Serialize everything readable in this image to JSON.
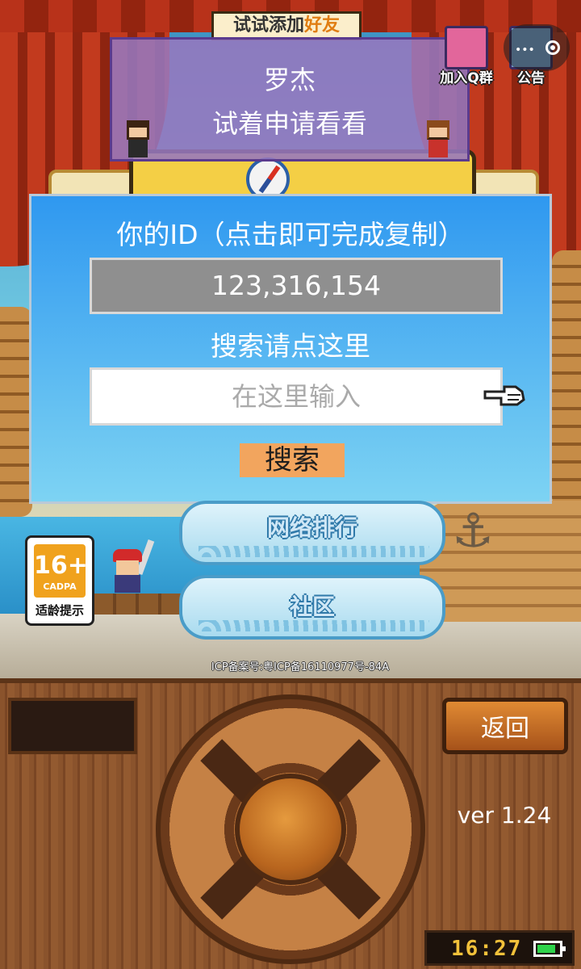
{
  "banner": {
    "title_prefix": "试试添加",
    "title_highlight": "好友"
  },
  "friend_suggestion": {
    "name": "罗杰",
    "hint": "试着申请看看"
  },
  "top_right": {
    "qq_group_label": "加入Q群",
    "notice_label": "公告"
  },
  "dialog": {
    "id_label": "你的ID（点击即可完成复制）",
    "id_value": "123,316,154",
    "search_label": "搜索请点这里",
    "search_placeholder": "在这里输入",
    "search_value": "",
    "search_button": "搜索"
  },
  "menu": {
    "ranking_label": "网络排行",
    "community_label": "社区"
  },
  "rating": {
    "age": "16+",
    "org": "CADPA",
    "caption": "适龄提示"
  },
  "icp": "ICP备案号:粤ICP备16110977号-84A",
  "console": {
    "back_label": "返回",
    "version": "ver 1.24",
    "clock": "16:27"
  },
  "colors": {
    "dialog_top": "#2f98f0",
    "dialog_bottom": "#7dd3f3",
    "search_button": "#f2a55e",
    "id_box": "#8f8f8f"
  }
}
